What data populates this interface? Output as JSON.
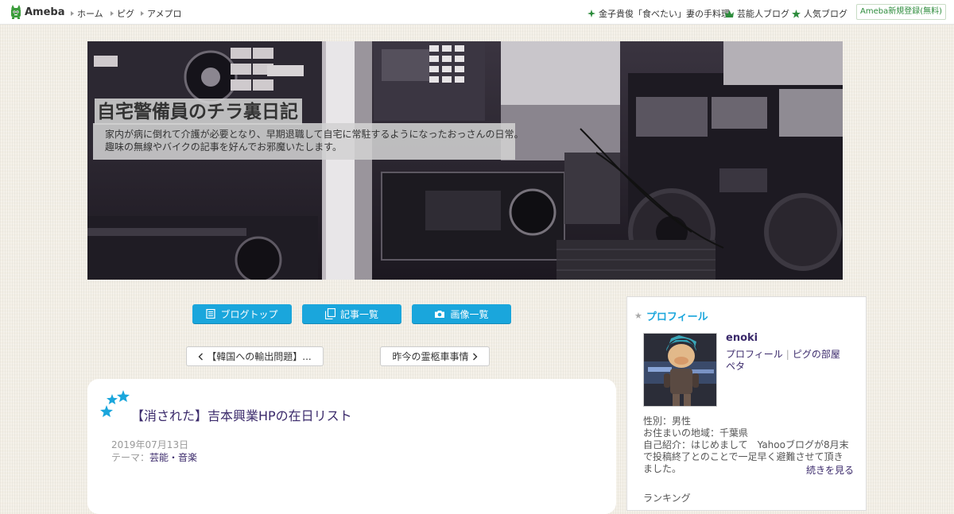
{
  "topbar": {
    "brand": "Ameba",
    "nav": [
      "ホーム",
      "ピグ",
      "アメプロ"
    ],
    "links": [
      {
        "label": "金子貴俊「食べたい」妻の手料理",
        "icon": "sparkle-icon"
      },
      {
        "label": "芸能人ブログ",
        "icon": "crown-icon"
      },
      {
        "label": "人気ブログ",
        "icon": "star-icon"
      }
    ],
    "register": "Ameba新規登録(無料)",
    "accent": "#2d8c3c"
  },
  "header": {
    "title": "自宅警備員のチラ裏日記",
    "description": [
      "家内が病に倒れて介護が必要となり、早期退職して自宅に常駐するようになったおっさんの日常。",
      "趣味の無線やバイクの記事を好んでお邪魔いたします。"
    ]
  },
  "nav_buttons": {
    "blog_top": "ブログトップ",
    "entry_list": "記事一覧",
    "image_list": "画像一覧",
    "color": "#1aa6dc"
  },
  "pager": {
    "prev": "【韓国への輸出問題】...",
    "next": "昨今の霊柩車事情"
  },
  "article": {
    "title": "【消された】吉本興業HPの在日リスト",
    "date": "2019年07月13日",
    "theme_label": "テーマ：",
    "theme": "芸能・音楽"
  },
  "profile": {
    "heading": "プロフィール",
    "username": "enoki",
    "link_profile": "プロフィール",
    "link_pigg": "ピグの部屋",
    "link_peta": "ペタ",
    "gender": "性別：男性",
    "location": "お住まいの地域：千葉県",
    "intro": "自己紹介：はじめまして　Yahooブログが8月末で投稿終了とのことで一足早く避難させて頂きました。",
    "more": "続きを見る",
    "ranking": "ランキング"
  }
}
